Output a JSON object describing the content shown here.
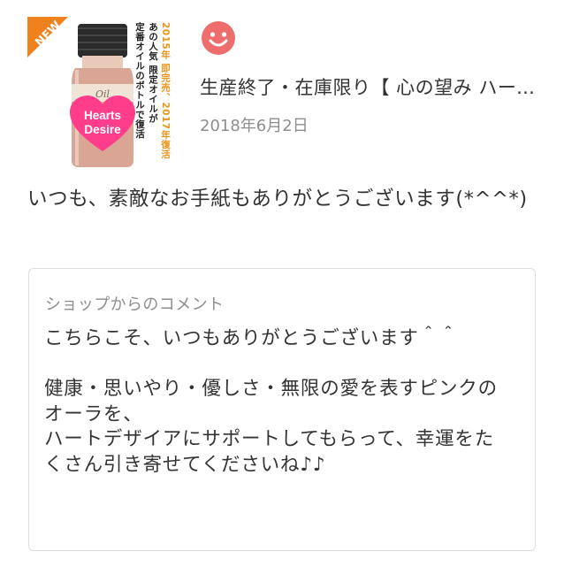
{
  "product": {
    "image_name": "product-thumbnail",
    "badge": "NEW",
    "badge_color": "#f0821e",
    "caption_orange": "2015年 即完売、2017年復活",
    "caption_line2": "あの人気 限定オイルが",
    "caption_line3": "定番オイルのボトルで復活",
    "heart_line1": "Hearts",
    "heart_line2": "Desire",
    "bottle_label": "Oil",
    "heart_color": "#ff3d8b"
  },
  "reviewer": {
    "icon": "smiley-icon",
    "icon_color": "#ee6e6e"
  },
  "item": {
    "title": "生産終了・在庫限り【 心の望み ハーツデザイア 】",
    "date": "2018年6月2日"
  },
  "review": {
    "text": "いつも、素敵なお手紙もありがとうございます(*^^*)"
  },
  "shop_comment": {
    "label": "ショップからのコメント",
    "text": "こちらこそ、いつもありがとうございます＾＾\n\n健康・思いやり・優しさ・無限の愛を表すピンクのオーラを、\nハートデザイアにサポートしてもらって、幸運をたくさん引き寄せてくださいね♪♪"
  }
}
